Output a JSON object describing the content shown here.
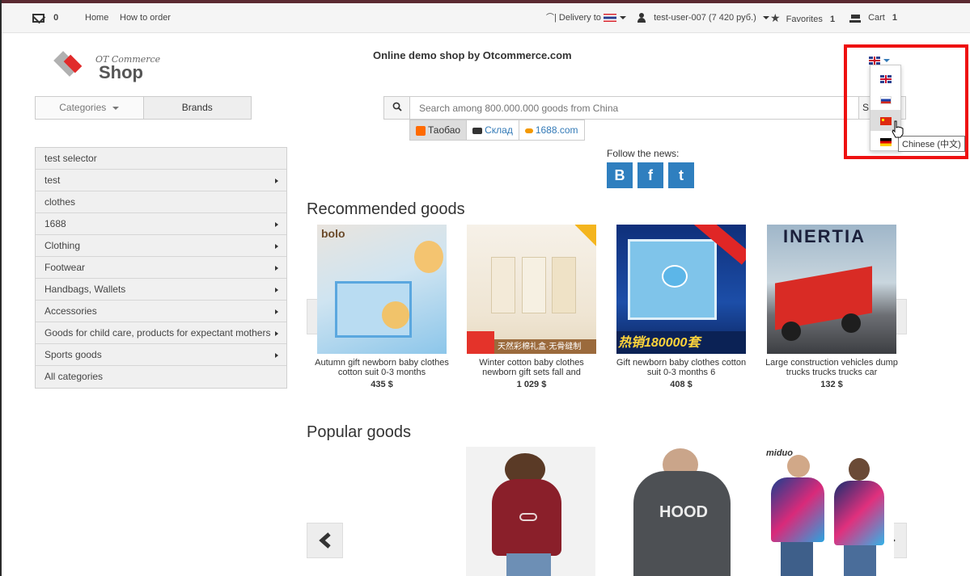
{
  "topbar": {
    "messages_count": "0",
    "home": "Home",
    "how_to_order": "How to order",
    "delivery": "| Delivery to",
    "user": "test-user-007 (7 420 руб.)",
    "favorites_label": "Favorites",
    "favorites_count": "1",
    "cart_label": "Cart",
    "cart_count": "1"
  },
  "header": {
    "logo_small": "OT Commerce",
    "logo_big": "Shop",
    "site_title": "Online demo shop by Otcommerce.com"
  },
  "nav_tabs": {
    "categories": "Categories",
    "brands": "Brands"
  },
  "search": {
    "placeholder": "Search among 800.000.000 goods from China",
    "button_label": "S"
  },
  "providers": [
    {
      "label": "Таобао"
    },
    {
      "label": "Склад"
    },
    {
      "label": "1688.com"
    }
  ],
  "sidebar": {
    "items": [
      {
        "label": "test selector",
        "has_arrow": false
      },
      {
        "label": "test",
        "has_arrow": true
      },
      {
        "label": "clothes",
        "has_arrow": false
      },
      {
        "label": "1688",
        "has_arrow": true
      },
      {
        "label": "Clothing",
        "has_arrow": true
      },
      {
        "label": "Footwear",
        "has_arrow": true
      },
      {
        "label": "Handbags, Wallets",
        "has_arrow": true
      },
      {
        "label": "Accessories",
        "has_arrow": true
      },
      {
        "label": "Goods for child care, products for expectant mothers",
        "has_arrow": true
      },
      {
        "label": "Sports goods",
        "has_arrow": true
      },
      {
        "label": "All categories",
        "has_arrow": false
      }
    ]
  },
  "follow": {
    "label": "Follow the news:",
    "vk": "B",
    "fb": "f",
    "tw": "t"
  },
  "recommended": {
    "title": "Recommended goods",
    "products": [
      {
        "name": "Autumn gift newborn baby clothes cotton suit 0-3 months",
        "price": "435 $",
        "image_text": "bolo"
      },
      {
        "name": "Winter cotton baby clothes newborn gift sets fall and",
        "price": "1 029 $",
        "image_text": "天然彩棉礼盒·无骨缝制"
      },
      {
        "name": "Gift newborn baby clothes cotton suit 0-3 months 6",
        "price": "408 $",
        "image_text": "热销180000套"
      },
      {
        "name": "Large construction vehicles dump trucks trucks trucks car",
        "price": "132 $",
        "image_text": "INERTIA"
      }
    ]
  },
  "popular": {
    "title": "Popular goods",
    "image_texts": [
      "HOOD",
      "miduo"
    ]
  },
  "language": {
    "current": "en",
    "options": [
      "en",
      "ru",
      "zh",
      "de"
    ],
    "hovered": "zh",
    "tooltip": "Chinese (中文)"
  },
  "colors": {
    "accent_blue": "#337ab7",
    "highlight_red": "#ee1111",
    "social_blue": "#2f7fbf"
  }
}
